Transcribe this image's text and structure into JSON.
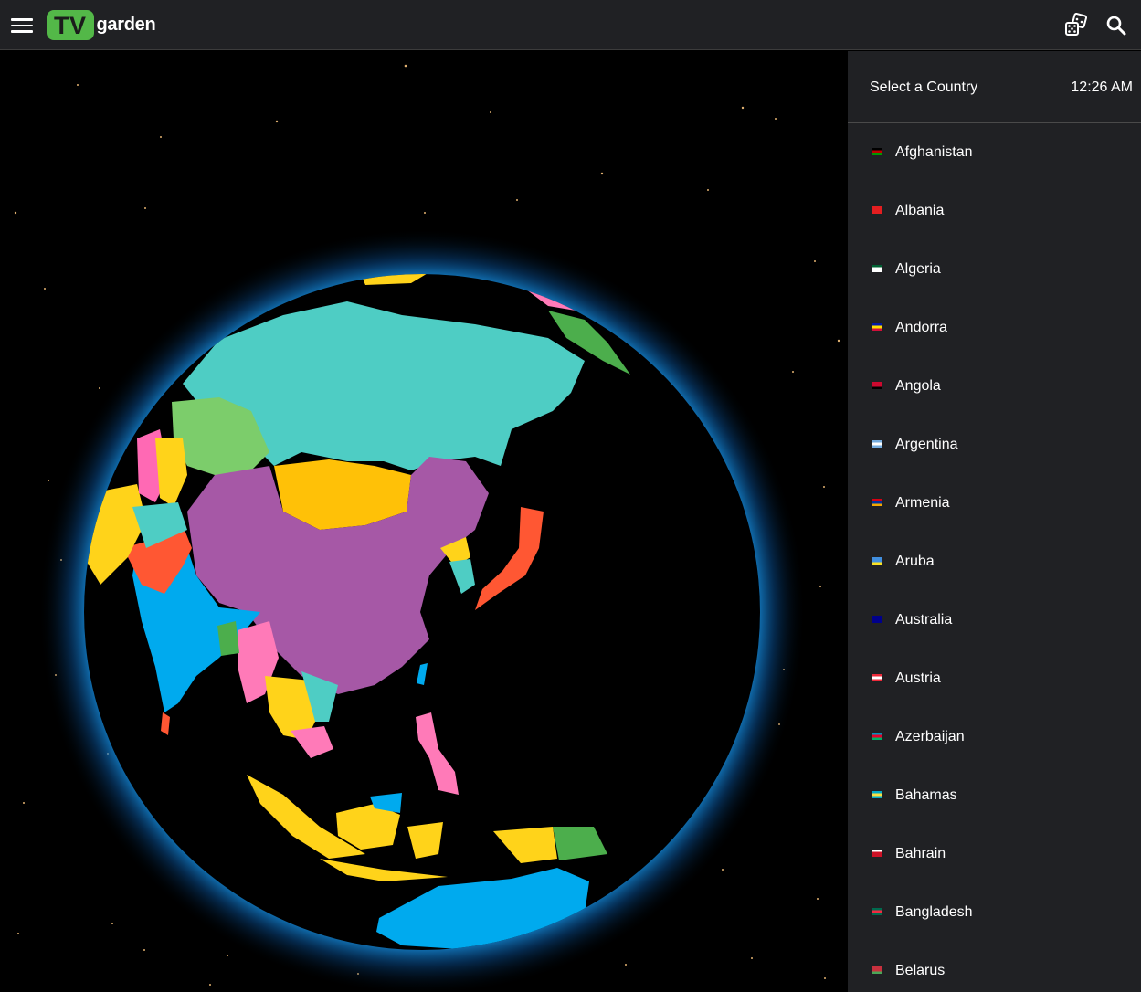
{
  "header": {
    "logo_tv": "TV",
    "logo_garden": "garden",
    "menu_icon": "hamburger-menu-icon",
    "dice_icon": "dice-icon",
    "search_icon": "search-icon"
  },
  "panel": {
    "title": "Select a Country",
    "time": "12:26 AM",
    "countries": [
      {
        "name": "Afghanistan",
        "flag": [
          "#000000",
          "#be0000",
          "#009900"
        ]
      },
      {
        "name": "Albania",
        "flag": [
          "#e41e20",
          "#e41e20",
          "#e41e20"
        ]
      },
      {
        "name": "Algeria",
        "flag": [
          "#006233",
          "#ffffff",
          "#ffffff"
        ]
      },
      {
        "name": "Andorra",
        "flag": [
          "#0018a8",
          "#fedf00",
          "#d0103a"
        ]
      },
      {
        "name": "Angola",
        "flag": [
          "#cc092f",
          "#cc092f",
          "#000000"
        ]
      },
      {
        "name": "Argentina",
        "flag": [
          "#74acdf",
          "#ffffff",
          "#74acdf"
        ]
      },
      {
        "name": "Armenia",
        "flag": [
          "#d90012",
          "#0033a0",
          "#f2a800"
        ]
      },
      {
        "name": "Aruba",
        "flag": [
          "#418fde",
          "#418fde",
          "#fbe122"
        ]
      },
      {
        "name": "Australia",
        "flag": [
          "#00008b",
          "#00008b",
          "#00008b"
        ]
      },
      {
        "name": "Austria",
        "flag": [
          "#ed2939",
          "#ffffff",
          "#ed2939"
        ]
      },
      {
        "name": "Azerbaijan",
        "flag": [
          "#0092bc",
          "#e4002b",
          "#00af66"
        ]
      },
      {
        "name": "Bahamas",
        "flag": [
          "#00abc9",
          "#fae042",
          "#00abc9"
        ]
      },
      {
        "name": "Bahrain",
        "flag": [
          "#ffffff",
          "#ce1126",
          "#ce1126"
        ]
      },
      {
        "name": "Bangladesh",
        "flag": [
          "#006a4e",
          "#f42a41",
          "#006a4e"
        ]
      },
      {
        "name": "Belarus",
        "flag": [
          "#c8313e",
          "#c8313e",
          "#4aa657"
        ]
      }
    ]
  }
}
